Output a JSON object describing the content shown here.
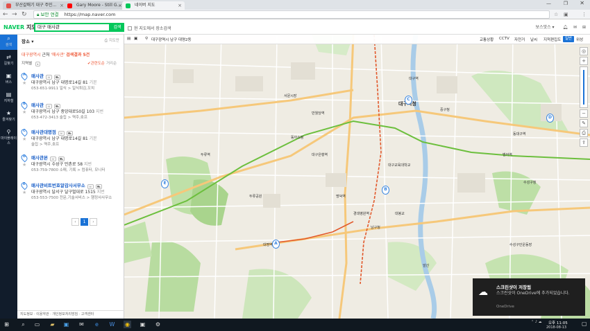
{
  "browser": {
    "tabs": [
      {
        "title": "부산갈매기 대구 주민..."
      },
      {
        "title": "Gary Moore - Still G..."
      },
      {
        "title": "네이버 지도"
      }
    ],
    "security_label": "보안 연결",
    "url": "https://map.naver.com",
    "colors": {
      "active_tab": "#f2f3f5",
      "tab_bg": "#dfe3e7"
    }
  },
  "header": {
    "logo_naver": "NAVER",
    "logo_map": "지도",
    "search_value": "대구 매사관",
    "search_button": "검색",
    "current_map_only": "현 지도에서 장소검색",
    "user": "보스맛스 ▾",
    "brand_color": "#03c75a"
  },
  "leftnav": [
    {
      "icon": "search-icon",
      "glyph": "⌕",
      "label": "검색"
    },
    {
      "icon": "route-icon",
      "glyph": "⇄",
      "label": "길찾기"
    },
    {
      "icon": "bus-icon",
      "glyph": "▣",
      "label": "버스"
    },
    {
      "icon": "subway-icon",
      "glyph": "▤",
      "label": "지하철"
    },
    {
      "icon": "star-icon",
      "glyph": "★",
      "label": "즐겨찾기"
    },
    {
      "icon": "pin-icon",
      "glyph": "⚲",
      "label": "마이플레이스"
    }
  ],
  "panel": {
    "tab_label": "장소",
    "print_label": "지도만",
    "summary_region": "대구광역시",
    "summary_mid": "근처",
    "summary_query": "'매사관'",
    "summary_count": "검색결과 5건",
    "filter_label": "지역별",
    "sort_relevance": "관련도순",
    "sort_distance": "거리순",
    "results": [
      {
        "letter": "A",
        "name": "매사관",
        "addr": "대구광역시 남구 대명로14길 81",
        "extra": "기본",
        "phone": "053-651-9911",
        "cat": "일식 > 일식튀김,꼬치"
      },
      {
        "letter": "B",
        "name": "매사관",
        "addr": "대구광역시 남구 중앙대로50길 103",
        "extra": "지번",
        "phone": "053-472-3413",
        "cat": "술집 > 역주,호프"
      },
      {
        "letter": "C",
        "name": "매사관대명점",
        "addr": "대구광역시 남구 대명로14길 81",
        "extra": "기본",
        "phone": "",
        "cat": "술집 > 역주,호프"
      },
      {
        "letter": "D",
        "name": "매사관본",
        "addr": "대구광역시 수성구 만촌로 58",
        "extra": "지번",
        "phone": "053-759-7800",
        "cat": "소매, 기록 > 컴퓨터, 모니터"
      },
      {
        "letter": "E",
        "name": "매사관비트번호알감사서무소",
        "addr": "대구광역시 달서구 달구벌대로 1515",
        "extra": "지번",
        "phone": "053-553-7500",
        "cat": "전문,기술서비스 > 행정사사무소"
      }
    ],
    "page": "1",
    "bottom_links": "지도정보 · 이용약관 · 개인정보처리방침 · 고객센터"
  },
  "map": {
    "location": "대구광역시 남구 대명2동",
    "toolbar": [
      "교통상황",
      "CCTV",
      "자전거",
      "날씨",
      "지적편집도"
    ],
    "view_modes": [
      "일반",
      "위성"
    ],
    "pins": [
      {
        "letter": "A"
      },
      {
        "letter": "B"
      },
      {
        "letter": "C"
      },
      {
        "letter": "D"
      },
      {
        "letter": "E"
      }
    ],
    "labels": [
      "대구시청",
      "대구역",
      "동대구역",
      "반월당역",
      "두류공원",
      "대구교육대학교",
      "수성구청",
      "범어역",
      "대봉교",
      "앞산",
      "대명역",
      "서문시장",
      "경대병원역",
      "명덕역",
      "대구은행역",
      "수성구민운동장",
      "동아쇼핑",
      "두류역",
      "중구청",
      "남구청"
    ]
  },
  "toast": {
    "title": "스크린샷이 저장됨",
    "body": "스크린샷이 OneDrive에 추가되었습니다.",
    "source": "OneDrive"
  },
  "taskbar": {
    "time": "오후 11:05",
    "date": "2018-08-13"
  }
}
